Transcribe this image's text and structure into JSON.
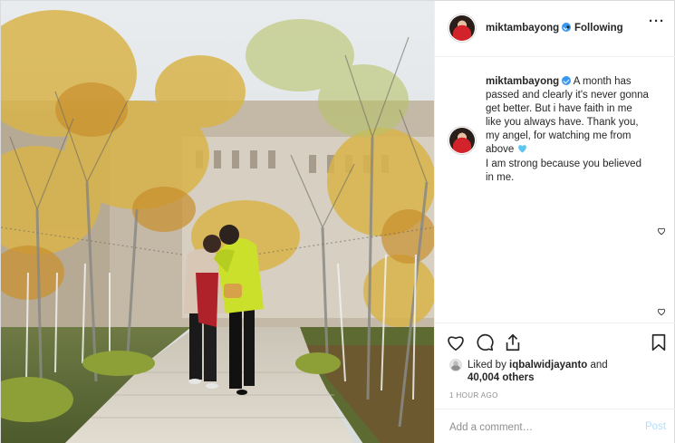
{
  "post": {
    "author": {
      "username": "miktambayong",
      "verified": true,
      "follow_status": "Following",
      "separator": "•"
    },
    "caption": {
      "username": "miktambayong",
      "text_part1": "A month has passed and clearly it's never gonna get better. But i have faith in me like you always have. Thank you, my angel, for watching me from above",
      "emoji": "blue-heart",
      "text_part2": "I am strong because you believed in me."
    },
    "likes": {
      "prefix": "Liked by",
      "liked_by_user": "iqbalwidjayanto",
      "connector": "and",
      "others": "40,004 others"
    },
    "timestamp": "1 HOUR AGO",
    "comment": {
      "placeholder": "Add a comment…",
      "post_label": "Post"
    },
    "colors": {
      "verified_badge": "#3897f0",
      "post_button_disabled": "#b2dffc",
      "heart_emoji": "#5bc6f0",
      "secondary_text": "#8e8e8e"
    },
    "icons": [
      "more-options-icon",
      "heart-icon",
      "comment-icon",
      "share-icon",
      "bookmark-icon",
      "verified-badge-icon",
      "comment-like-icon"
    ]
  }
}
